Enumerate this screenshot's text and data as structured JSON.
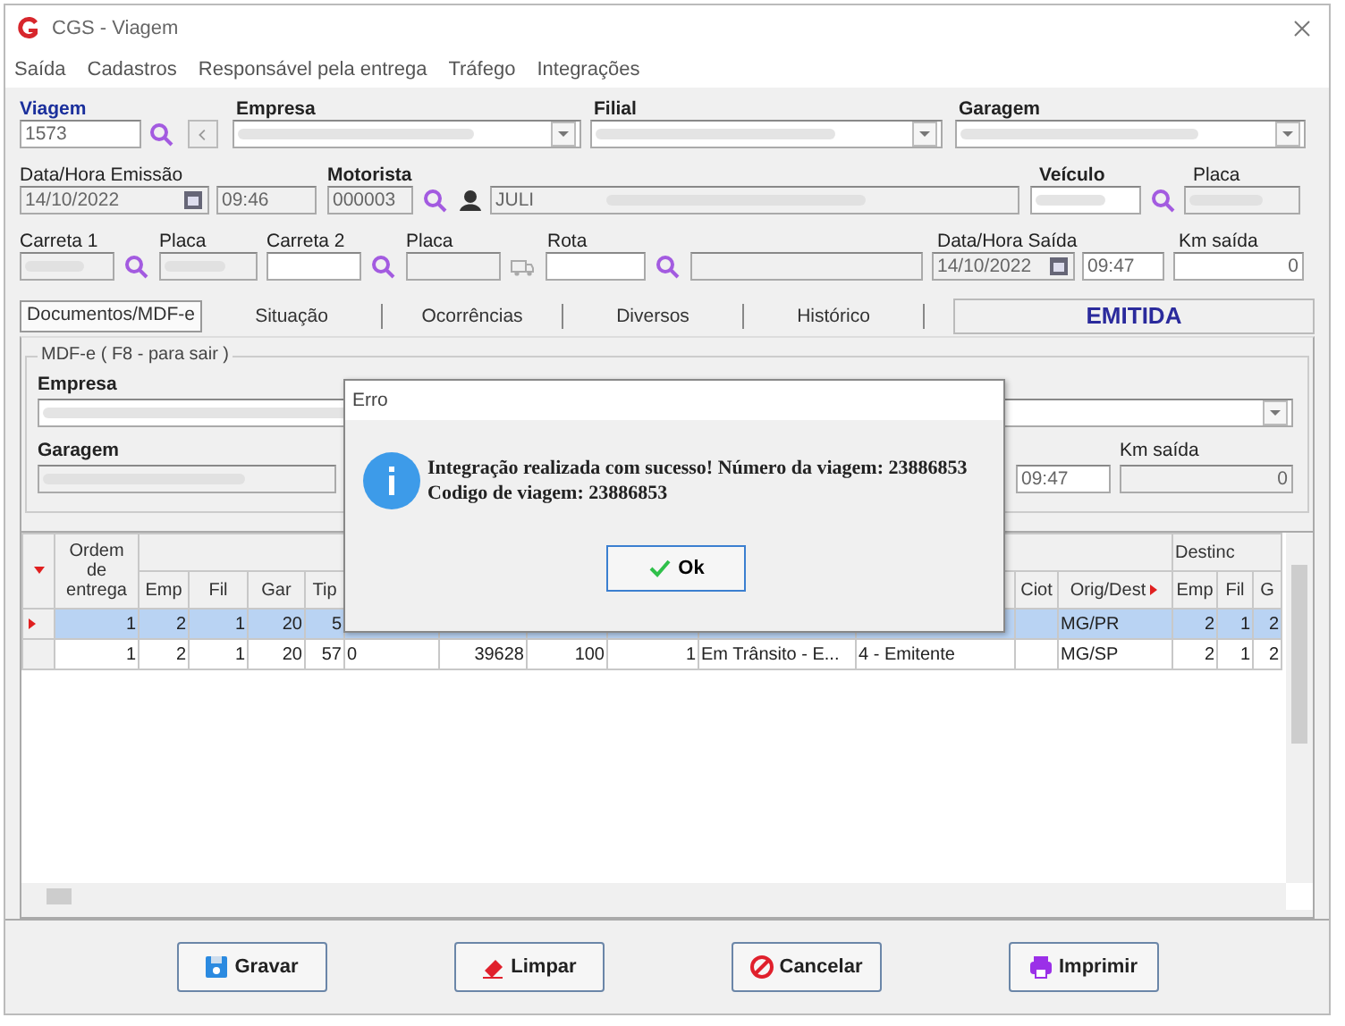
{
  "window": {
    "title": "CGS - Viagem"
  },
  "menu": [
    "Saída",
    "Cadastros",
    "Responsável pela entrega",
    "Tráfego",
    "Integrações"
  ],
  "form": {
    "viagem_label": "Viagem",
    "viagem": "1573",
    "empresa_label": "Empresa",
    "filial_label": "Filial",
    "garagem_label": "Garagem",
    "emissao_label": "Data/Hora Emissão",
    "emissao_date": "14/10/2022",
    "emissao_time": "09:46",
    "motorista_label": "Motorista",
    "motorista_code": "000003",
    "motorista_name": "JULI",
    "veiculo_label": "Veículo",
    "placa_label": "Placa",
    "carreta1_label": "Carreta 1",
    "placa1_label": "Placa",
    "carreta2_label": "Carreta 2",
    "placa2_label": "Placa",
    "rota_label": "Rota",
    "saida_label": "Data/Hora Saída",
    "saida_date": "14/10/2022",
    "saida_time": "09:47",
    "km_label": "Km saída",
    "km": "0"
  },
  "tabs": [
    {
      "label": "Documentos/MDF-e",
      "selected": true
    },
    {
      "label": "Situação",
      "selected": false
    },
    {
      "label": "Ocorrências",
      "selected": false
    },
    {
      "label": "Diversos",
      "selected": false
    },
    {
      "label": "Histórico",
      "selected": false
    }
  ],
  "status": "EMITIDA",
  "mdfe": {
    "title": "MDF-e ( F8 - para sair )",
    "empresa_label": "Empresa",
    "garagem_label": "Garagem",
    "time": "09:47",
    "km_label": "Km saída",
    "km": "0"
  },
  "table": {
    "group_header": "Destinc",
    "columns": [
      "Ordem de entrega",
      "Emp",
      "Fil",
      "Gar",
      "Tip",
      null,
      null,
      null,
      null,
      null,
      null,
      "Ciot",
      "Orig/Dest",
      "Emp",
      "Fil",
      "G"
    ],
    "rows": [
      {
        "selected": true,
        "cells": [
          "1",
          "2",
          "1",
          "20",
          "5",
          null,
          null,
          null,
          null,
          null,
          null,
          null,
          "MG/PR",
          "2",
          "1",
          "2"
        ]
      },
      {
        "selected": false,
        "cells": [
          "1",
          "2",
          "1",
          "20",
          "57",
          "0",
          "39628",
          "100",
          "1",
          "Em Trânsito - E...",
          "4 - Emitente",
          null,
          "MG/SP",
          "2",
          "1",
          "2"
        ]
      }
    ]
  },
  "buttons": [
    "Gravar",
    "Limpar",
    "Cancelar",
    "Imprimir"
  ],
  "dialog": {
    "title": "Erro",
    "line1": "Integração realizada com sucesso! Número da viagem: 23886853",
    "line2": "Codigo de viagem: 23886853",
    "ok": "Ok"
  }
}
